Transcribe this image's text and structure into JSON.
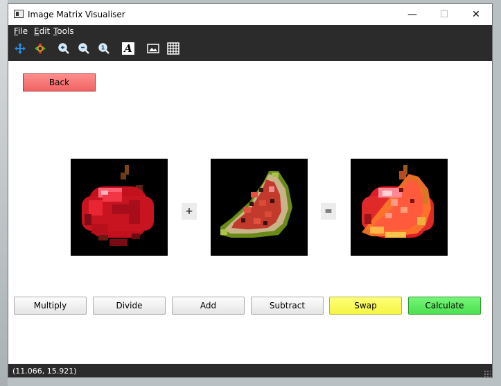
{
  "window": {
    "title": "Image Matrix Visualiser"
  },
  "titlebar": {
    "minimize_glyph": "—",
    "maximize_glyph": "☐",
    "close_glyph": "✕"
  },
  "menu": [
    {
      "mnemonic": "F",
      "rest": "ile"
    },
    {
      "mnemonic": "E",
      "rest": "dit"
    },
    {
      "mnemonic": "T",
      "rest": "ools"
    }
  ],
  "toolbar": {
    "icons": [
      "move-icon",
      "pan-icon",
      "zoom-in-icon",
      "zoom-out-icon",
      "zoom-reset-icon",
      "font-icon",
      "image-icon",
      "grid-icon"
    ],
    "font_glyph": "A",
    "zoom_reset_glyph": "1"
  },
  "back_button": {
    "label": "Back"
  },
  "operands": {
    "left_image": "apple-image",
    "right_image": "watermelon-image",
    "result_image": "result-image",
    "plus": "+",
    "equals": "="
  },
  "actions": [
    "Multiply",
    "Divide",
    "Add",
    "Subtract",
    "Swap",
    "Calculate"
  ],
  "colors": {
    "back": "#f06464",
    "swap": "#f5f542",
    "calculate": "#4ce04f",
    "chrome": "#2b2b2b"
  },
  "status": {
    "coords": "(11.066, 15.921)"
  }
}
